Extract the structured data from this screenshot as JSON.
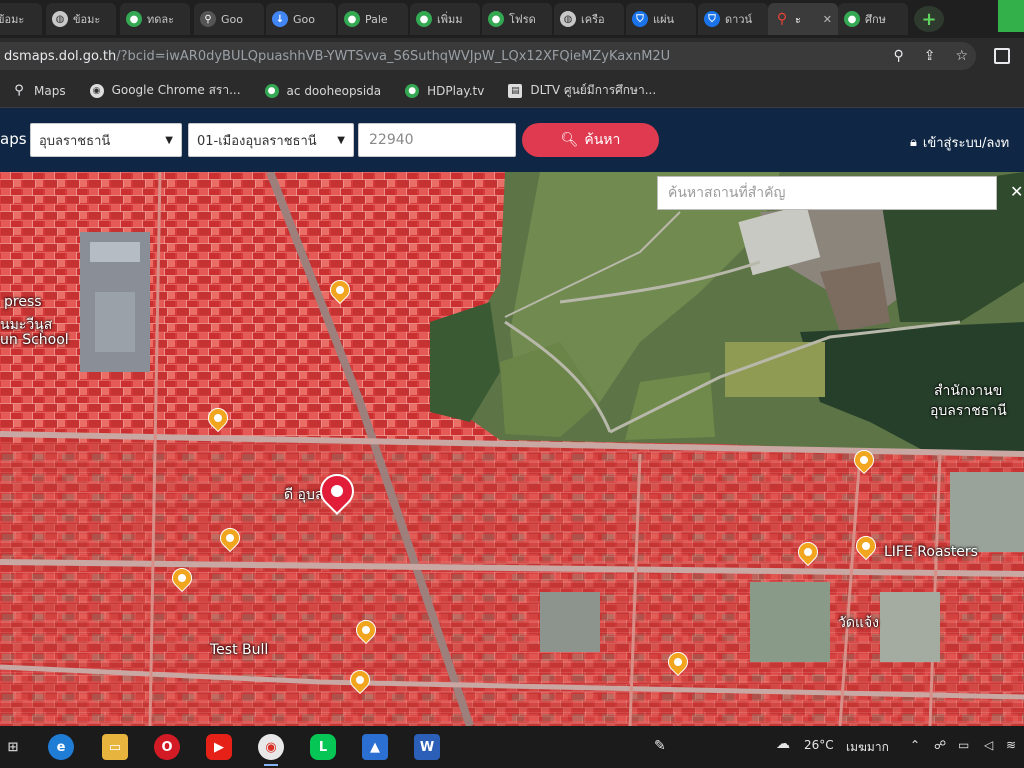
{
  "browser": {
    "tabs": [
      {
        "title": "ข้อมะ",
        "icon": "globe-icon",
        "color": "#c8c8c8"
      },
      {
        "title": "ข้อมะ",
        "icon": "globe-icon",
        "color": "#c8c8c8"
      },
      {
        "title": "ทดละ",
        "icon": "green-circle-icon",
        "color": "#34a853"
      },
      {
        "title": "Goo",
        "icon": "maps-pin-icon",
        "color": "#c8c8c8"
      },
      {
        "title": "Goo",
        "icon": "download-icon",
        "color": "#4285f4"
      },
      {
        "title": "Pale",
        "icon": "green-circle-icon",
        "color": "#34a853"
      },
      {
        "title": "เพิ่มม",
        "icon": "green-circle-icon",
        "color": "#34a853"
      },
      {
        "title": "โฟรด",
        "icon": "green-circle-icon",
        "color": "#34a853"
      },
      {
        "title": "เครือ",
        "icon": "globe-icon",
        "color": "#c8c8c8"
      },
      {
        "title": "แผ่น",
        "icon": "shield-icon",
        "color": "#1a73e8"
      },
      {
        "title": "ดาวน์",
        "icon": "shield-icon",
        "color": "#1a73e8"
      },
      {
        "title": "ะ",
        "icon": "location-icon",
        "color": "#ea4335"
      },
      {
        "title": "ศึกษ",
        "icon": "green-circle-icon",
        "color": "#34a853"
      }
    ],
    "url_domain": "dsmaps.dol.go.th",
    "url_path": "/?bcid=iwAR0dyBULQpuashhVB-YWTSvva_S6SuthqWVJpW_LQx12XFQieMZyKaxnM2U",
    "bookmarks": [
      {
        "label": "Maps",
        "icon": "maps-pin-icon"
      },
      {
        "label": "Google Chrome สรา...",
        "icon": "chrome-icon"
      },
      {
        "label": "ac dooheopsida",
        "icon": "green-circle-icon"
      },
      {
        "label": "HDPlay.tv",
        "icon": "green-circle-icon"
      },
      {
        "label": "DLTV ศูนย์มีการศึกษา...",
        "icon": "tv-icon"
      }
    ]
  },
  "site": {
    "brand": "aps",
    "province": "อุบลราชธานี",
    "district": "01-เมืองอุบลราชธานี",
    "parcel_number": "22940",
    "search_label": "ค้นหา",
    "login_label": "เข้าสู่ระบบ/ลงท"
  },
  "map": {
    "place_search_placeholder": "ค้นหาสถานที่สำคัญ",
    "labels": [
      {
        "text": "press",
        "name": "map-label-press"
      },
      {
        "text": "นมะวีนุส",
        "name": "map-label-school-thai"
      },
      {
        "text": "un School",
        "name": "map-label-school"
      },
      {
        "text": "สำนักงานข",
        "name": "map-label-office"
      },
      {
        "text": "อุบลราชธานี",
        "name": "map-label-ubon"
      },
      {
        "text": "LIFE Roasters",
        "name": "map-label-life-roasters"
      },
      {
        "text": "วัดแจ้ง",
        "name": "map-label-wat"
      },
      {
        "text": "Test Bull",
        "name": "map-label-test"
      },
      {
        "text": "ดี อุบล",
        "name": "map-label-center"
      }
    ]
  },
  "taskbar": {
    "temperature": "26°C",
    "weather": "เมฆมาก",
    "apps": [
      "windows-icon",
      "edge-icon",
      "file-explorer-icon",
      "opera-icon",
      "youtube-icon",
      "chrome-icon",
      "line-icon",
      "photos-icon",
      "word-icon"
    ]
  }
}
